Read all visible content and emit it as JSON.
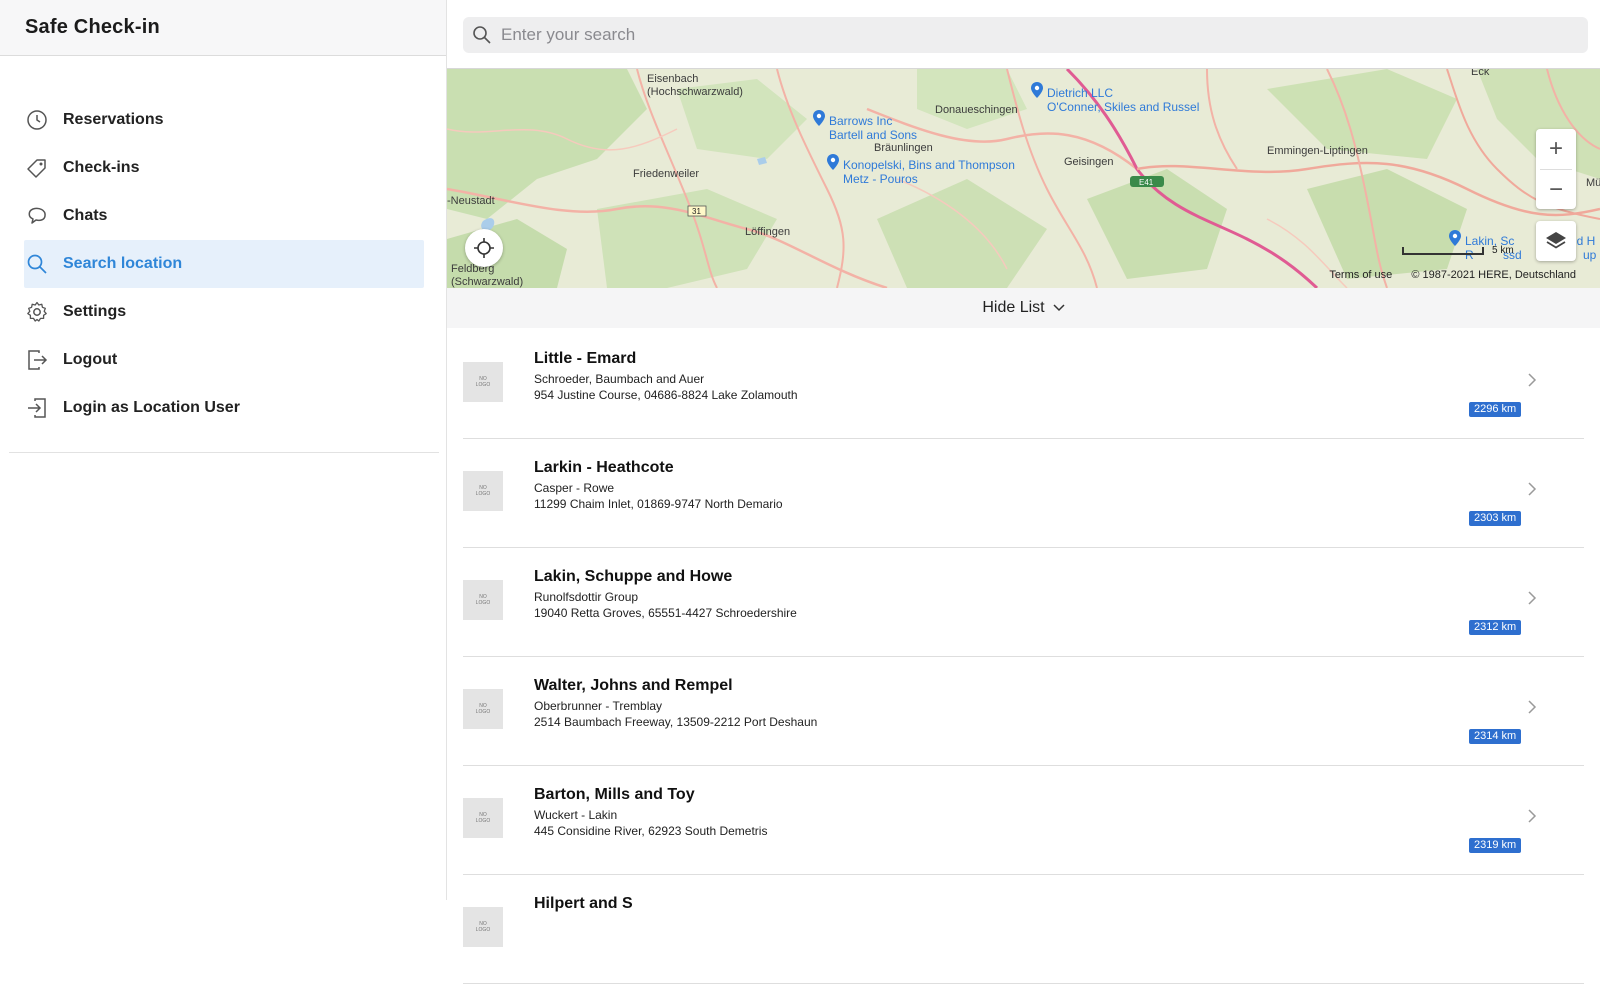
{
  "app": {
    "title": "Safe Check-in"
  },
  "sidebar": {
    "items": [
      {
        "label": "Reservations",
        "icon": "clock-icon",
        "active": false
      },
      {
        "label": "Check-ins",
        "icon": "tag-icon",
        "active": false
      },
      {
        "label": "Chats",
        "icon": "chat-icon",
        "active": false
      },
      {
        "label": "Search location",
        "icon": "search-icon",
        "active": true
      },
      {
        "label": "Settings",
        "icon": "gear-icon",
        "active": false
      },
      {
        "label": "Logout",
        "icon": "logout-icon",
        "active": false
      },
      {
        "label": "Login as Location User",
        "icon": "login-icon",
        "active": false
      }
    ]
  },
  "search": {
    "placeholder": "Enter your search",
    "value": ""
  },
  "map": {
    "places": [
      "Eisenbach\n(Hochschwarzwald)",
      "Donaueschingen",
      "Friedenweiler",
      "Bräunlingen",
      "Geisingen",
      "Emmingen-Liptingen",
      "-Neustadt",
      "Löffingen",
      "Feldberg\n(Schwarzwald)",
      "Eck",
      "Mü"
    ],
    "poi_labels": [
      "Dietrich LLC",
      "O'Conner, Skiles and Russel",
      "Barrows Inc",
      "Bartell and Sons",
      "Konopelski, Bins and Thompson",
      "Metz - Pouros",
      "Lakin, Sc",
      "nd H",
      "R",
      "ssd",
      "up"
    ],
    "road_labels": [
      "31",
      "E41"
    ],
    "scale_label": "5 km",
    "terms": "Terms of use",
    "copyright": "© 1987-2021 HERE, Deutschland",
    "zoom_in": "+",
    "zoom_out": "−"
  },
  "list_toggle": {
    "label": "Hide List"
  },
  "logo_placeholder": {
    "line1": "NO",
    "line2": "LOGO"
  },
  "results": [
    {
      "title": "Little - Emard",
      "subtitle": "Schroeder, Baumbach and Auer",
      "address": "954 Justine Course, 04686-8824 Lake Zolamouth",
      "distance": "2296 km"
    },
    {
      "title": "Larkin - Heathcote",
      "subtitle": "Casper - Rowe",
      "address": "11299 Chaim Inlet, 01869-9747 North Demario",
      "distance": "2303 km"
    },
    {
      "title": "Lakin, Schuppe and Howe",
      "subtitle": "Runolfsdottir Group",
      "address": "19040 Retta Groves, 65551-4427 Schroedershire",
      "distance": "2312 km"
    },
    {
      "title": "Walter, Johns and Rempel",
      "subtitle": "Oberbrunner - Tremblay",
      "address": "2514 Baumbach Freeway, 13509-2212 Port Deshaun",
      "distance": "2314 km"
    },
    {
      "title": "Barton, Mills and Toy",
      "subtitle": "Wuckert - Lakin",
      "address": "445 Considine River, 62923 South Demetris",
      "distance": "2319 km"
    },
    {
      "title": "Hilpert and S",
      "subtitle": "",
      "address": "",
      "distance": ""
    }
  ],
  "colors": {
    "accent": "#2f86d8",
    "active_bg": "#e6f0fb",
    "badge": "#2e6fcf"
  }
}
